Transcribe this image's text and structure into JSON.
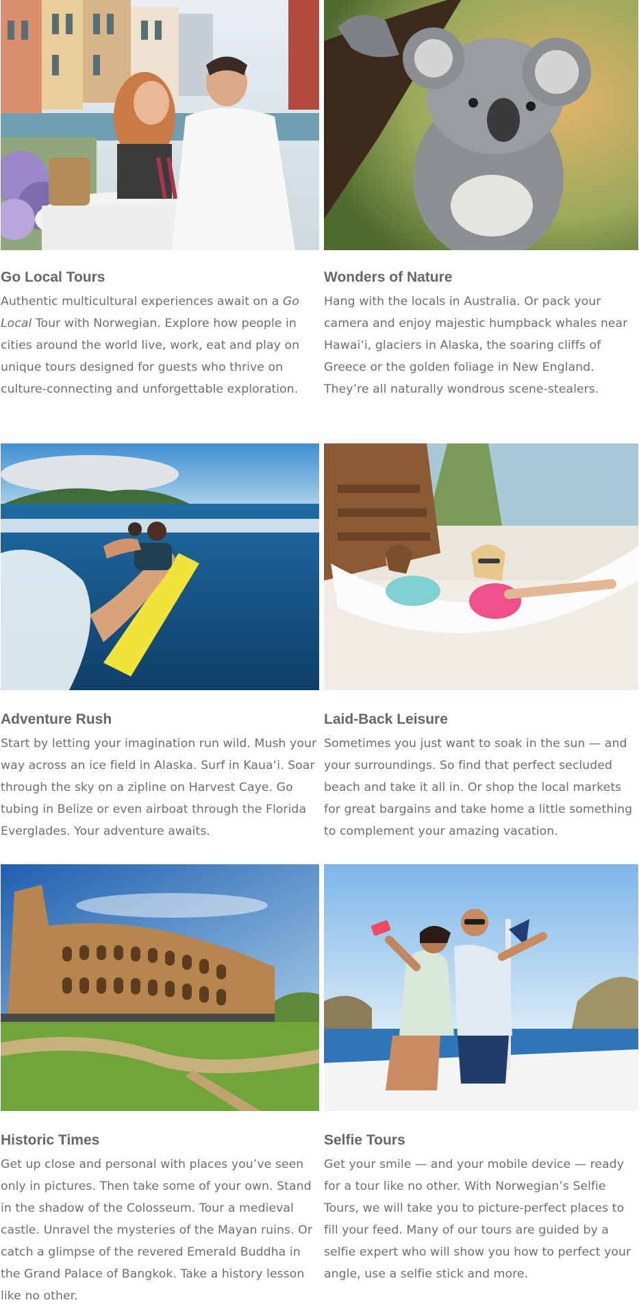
{
  "cards": [
    {
      "title": "Go Local Tours",
      "desc_pre": "Authentic multicultural experiences await on a ",
      "desc_em": "Go Local",
      "desc_post": " Tour with Norwegian. Explore how people in cities around the world live, work, eat and play on unique tours designed for guests who thrive on culture-connecting and unforgettable exploration.",
      "image": "couple-dining-venice-canal"
    },
    {
      "title": "Wonders of Nature",
      "desc": "Hang with the locals in Australia. Or pack your camera and enjoy majestic humpback whales near Hawai‘i, glaciers in Alaska, the soaring cliffs of Greece or the golden foliage in New England. They’re all naturally wondrous scene-stealers.",
      "image": "koala-on-branch"
    },
    {
      "title": "Adventure Rush",
      "desc": "Start by letting your imagination run wild. Mush your way across an ice field in Alaska. Surf in Kaua‘i. Soar through the sky on a zipline on Harvest Caye. Go tubing in Belize or even airboat through the Florida Everglades. Your adventure awaits.",
      "image": "surfers-in-ocean"
    },
    {
      "title": "Laid-Back Leisure",
      "desc": "Sometimes you just want to soak in the sun — and your surroundings. So find that perfect secluded beach and take it all in. Or shop the local markets for great bargains and take home a little something to complement your amazing vacation.",
      "image": "mother-daughter-beach-hammock"
    },
    {
      "title": "Historic Times",
      "desc": "Get up close and personal with places you’ve seen only in pictures. Then take some of your own. Stand in the shadow of the Colosseum. Tour a medieval castle. Unravel the mysteries of the Mayan ruins. Or catch a glimpse of the revered Emerald Buddha in the Grand Palace of Bangkok. Take a history lesson like no other.",
      "image": "colosseum-rome"
    },
    {
      "title": "Selfie Tours",
      "desc": "Get your smile — and your mobile device — ready for a tour like no other. With Norwegian’s Selfie Tours, we will take you to picture-perfect places to fill your feed. Many of our tours are guided by a selfie expert who will show you how to perfect your angle, use a selfie stick and more.",
      "image": "couple-selfie-on-boat"
    }
  ],
  "colors": {
    "title": "#666666",
    "text": "#6e6e6e",
    "background": "#ffffff"
  }
}
